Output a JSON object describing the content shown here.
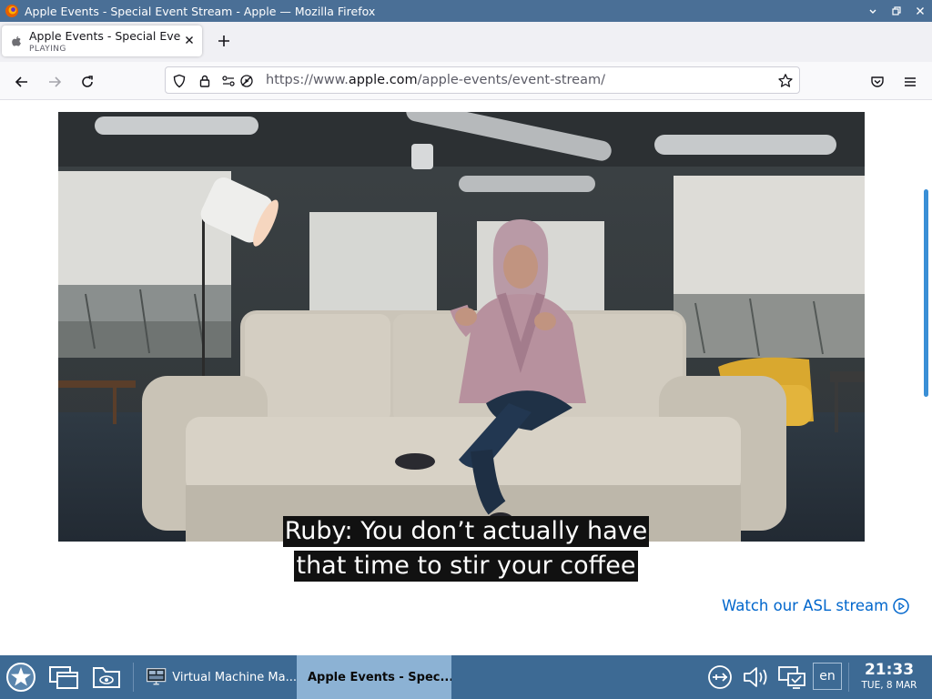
{
  "window": {
    "title": "Apple Events - Special Event Stream - Apple — Mozilla Firefox",
    "controls": [
      "minimize",
      "maximize",
      "close"
    ]
  },
  "tab": {
    "title": "Apple Events - Special Event Stream - Apple",
    "status": "PLAYING",
    "close_icon": "close-icon",
    "new_tab_icon": "plus-icon"
  },
  "navigation": {
    "back_icon": "arrow-left-icon",
    "forward_icon": "arrow-right-icon",
    "reload_icon": "reload-icon",
    "url_prefix": "https://www.",
    "url_host": "apple.com",
    "url_path": "/apple-events/event-stream/",
    "bookmark_icon": "star-icon",
    "pocket_icon": "pocket-icon",
    "menu_icon": "hamburger-menu-icon"
  },
  "video": {
    "subtitle_line1": "Ruby: You don’t actually have",
    "subtitle_line2": "that time to stir your coffee"
  },
  "page": {
    "asl_link": "Watch our ASL stream",
    "link_color": "#0066cc"
  },
  "taskbar": {
    "tasks": [
      {
        "label": "Virtual Machine Ma...",
        "icon": "monitor-icon",
        "active": false
      },
      {
        "label": "Apple Events - Spec...",
        "icon": "firefox-icon",
        "active": true
      }
    ],
    "language": "en",
    "time": "21:33",
    "date": "TUE, 8 MAR"
  },
  "colors": {
    "titlebar": "#4a6f96",
    "taskbar": "#3d6a94",
    "active_task": "#8cb2d4"
  }
}
